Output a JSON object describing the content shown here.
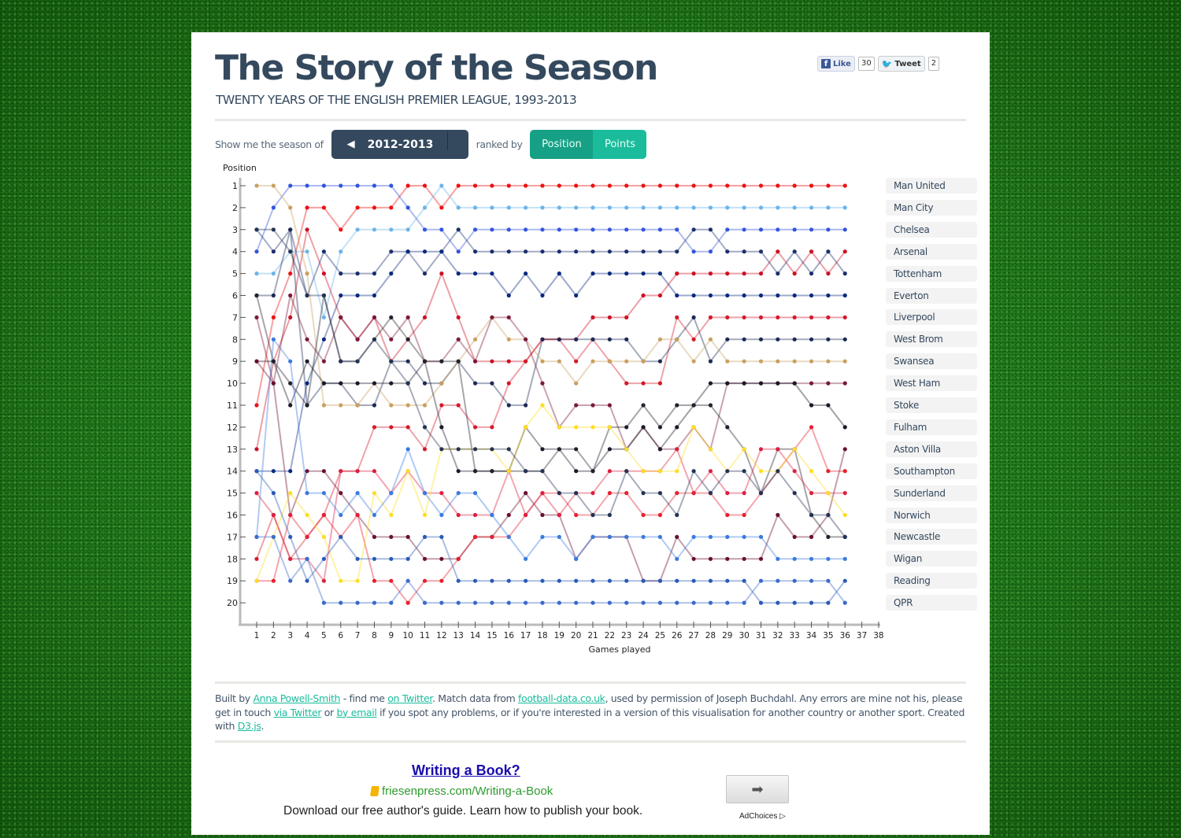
{
  "header": {
    "title": "The Story of the Season",
    "subtitle": "TWENTY YEARS OF THE ENGLISH PREMIER LEAGUE, 1993-2013"
  },
  "social": {
    "like_label": "Like",
    "like_count": "30",
    "tweet_label": "Tweet",
    "tweet_count": "2"
  },
  "controls": {
    "season_prompt": "Show me the season of",
    "season_value": "2012-2013",
    "rank_prompt": "ranked by",
    "rank_options": [
      "Position",
      "Points"
    ],
    "rank_selected": "Position"
  },
  "chart_data": {
    "type": "line",
    "title": "",
    "xlabel": "Games played",
    "ylabel": "Position",
    "xlim": [
      1,
      38
    ],
    "ylim": [
      1,
      20
    ],
    "x_ticks": [
      1,
      2,
      3,
      4,
      5,
      6,
      7,
      8,
      9,
      10,
      11,
      12,
      13,
      14,
      15,
      16,
      17,
      18,
      19,
      20,
      21,
      22,
      23,
      24,
      25,
      26,
      27,
      28,
      29,
      30,
      31,
      32,
      33,
      34,
      35,
      36,
      37,
      38
    ],
    "y_ticks": [
      1,
      2,
      3,
      4,
      5,
      6,
      7,
      8,
      9,
      10,
      11,
      12,
      13,
      14,
      15,
      16,
      17,
      18,
      19,
      20
    ],
    "games_played": 36,
    "legend_placement": "right",
    "series": [
      {
        "name": "Man United",
        "color": "#ee1111",
        "values": [
          11,
          7,
          5,
          2,
          2,
          3,
          2,
          2,
          2,
          1,
          1,
          2,
          1,
          1,
          1,
          1,
          1,
          1,
          1,
          1,
          1,
          1,
          1,
          1,
          1,
          1,
          1,
          1,
          1,
          1,
          1,
          1,
          1,
          1,
          1,
          1
        ]
      },
      {
        "name": "Man City",
        "color": "#6cb4e8",
        "values": [
          5,
          5,
          4,
          4,
          7,
          4,
          3,
          3,
          3,
          3,
          2,
          1,
          2,
          2,
          2,
          2,
          2,
          2,
          2,
          2,
          2,
          2,
          2,
          2,
          2,
          2,
          2,
          2,
          2,
          2,
          2,
          2,
          2,
          2,
          2,
          2
        ]
      },
      {
        "name": "Chelsea",
        "color": "#3355dd",
        "values": [
          4,
          2,
          1,
          1,
          1,
          1,
          1,
          1,
          1,
          2,
          3,
          3,
          4,
          3,
          3,
          3,
          3,
          3,
          3,
          3,
          3,
          3,
          3,
          3,
          3,
          3,
          4,
          4,
          3,
          3,
          3,
          3,
          3,
          3,
          3,
          3
        ]
      },
      {
        "name": "Arsenal",
        "color": "#cc1122",
        "values": [
          13,
          9,
          7,
          3,
          5,
          7,
          8,
          7,
          9,
          8,
          7,
          5,
          7,
          9,
          9,
          9,
          9,
          8,
          8,
          8,
          7,
          7,
          7,
          6,
          6,
          5,
          5,
          5,
          5,
          5,
          5,
          4,
          5,
          4,
          5,
          4
        ]
      },
      {
        "name": "Tottenham",
        "color": "#1a2f6e",
        "values": [
          3,
          4,
          3,
          6,
          4,
          5,
          5,
          5,
          4,
          4,
          5,
          4,
          3,
          4,
          4,
          4,
          4,
          4,
          4,
          4,
          4,
          4,
          4,
          4,
          4,
          4,
          3,
          3,
          4,
          4,
          4,
          5,
          4,
          5,
          4,
          5
        ]
      },
      {
        "name": "Everton",
        "color": "#0a2a80",
        "values": [
          14,
          14,
          14,
          10,
          8,
          6,
          6,
          6,
          5,
          4,
          4,
          4,
          5,
          5,
          5,
          6,
          5,
          6,
          5,
          6,
          5,
          5,
          5,
          5,
          5,
          6,
          6,
          6,
          6,
          6,
          6,
          6,
          6,
          6,
          6,
          6
        ]
      },
      {
        "name": "Liverpool",
        "color": "#d41a2a",
        "values": [
          18,
          16,
          18,
          17,
          16,
          14,
          14,
          12,
          12,
          12,
          13,
          11,
          11,
          12,
          12,
          10,
          9,
          8,
          8,
          9,
          8,
          9,
          10,
          10,
          10,
          7,
          8,
          7,
          7,
          7,
          7,
          7,
          7,
          7,
          7,
          7
        ]
      },
      {
        "name": "West Brom",
        "color": "#1c2a55",
        "values": [
          6,
          6,
          3,
          11,
          10,
          10,
          11,
          11,
          9,
          9,
          10,
          10,
          9,
          10,
          10,
          11,
          11,
          8,
          8,
          8,
          8,
          8,
          8,
          9,
          9,
          8,
          7,
          9,
          8,
          8,
          8,
          8,
          8,
          8,
          8,
          8
        ]
      },
      {
        "name": "Swansea",
        "color": "#c9a060",
        "values": [
          1,
          1,
          2,
          5,
          11,
          11,
          11,
          10,
          11,
          11,
          11,
          10,
          9,
          8,
          7,
          8,
          8,
          9,
          9,
          10,
          9,
          9,
          9,
          9,
          8,
          8,
          9,
          8,
          9,
          9,
          9,
          9,
          9,
          9,
          9,
          9
        ]
      },
      {
        "name": "West Ham",
        "color": "#7a1a3a",
        "values": [
          7,
          10,
          6,
          8,
          9,
          7,
          8,
          7,
          8,
          7,
          9,
          9,
          8,
          9,
          7,
          7,
          8,
          10,
          12,
          11,
          11,
          11,
          13,
          12,
          13,
          13,
          12,
          13,
          10,
          10,
          10,
          10,
          10,
          10,
          10,
          10
        ]
      },
      {
        "name": "Stoke",
        "color": "#1a1a2a",
        "values": [
          9,
          9,
          11,
          9,
          10,
          10,
          10,
          10,
          10,
          10,
          9,
          12,
          14,
          14,
          14,
          14,
          12,
          13,
          13,
          14,
          14,
          13,
          13,
          12,
          13,
          12,
          11,
          10,
          10,
          10,
          10,
          10,
          10,
          11,
          11,
          12
        ]
      },
      {
        "name": "Fulham",
        "color": "#22222e",
        "values": [
          6,
          9,
          10,
          11,
          6,
          9,
          9,
          8,
          7,
          8,
          9,
          9,
          9,
          14,
          14,
          14,
          14,
          14,
          13,
          13,
          14,
          12,
          12,
          11,
          12,
          11,
          11,
          11,
          12,
          13,
          15,
          13,
          13,
          16,
          17,
          17
        ]
      },
      {
        "name": "Aston Villa",
        "color": "#6a1030",
        "values": [
          9,
          10,
          16,
          14,
          14,
          15,
          16,
          17,
          17,
          17,
          18,
          18,
          18,
          17,
          17,
          16,
          15,
          16,
          16,
          18,
          17,
          17,
          17,
          19,
          19,
          17,
          18,
          18,
          18,
          18,
          18,
          16,
          17,
          17,
          16,
          13
        ]
      },
      {
        "name": "Southampton",
        "color": "#e52030",
        "values": [
          19,
          19,
          16,
          17,
          16,
          17,
          16,
          19,
          19,
          20,
          19,
          19,
          18,
          17,
          17,
          17,
          16,
          15,
          15,
          16,
          16,
          15,
          15,
          16,
          16,
          15,
          15,
          15,
          16,
          16,
          15,
          14,
          13,
          12,
          14,
          14
        ]
      },
      {
        "name": "Sunderland",
        "color": "#dd2040",
        "values": [
          15,
          16,
          18,
          18,
          19,
          14,
          14,
          14,
          15,
          14,
          15,
          15,
          16,
          16,
          16,
          14,
          16,
          15,
          16,
          15,
          15,
          14,
          14,
          14,
          14,
          13,
          15,
          14,
          15,
          15,
          13,
          13,
          14,
          15,
          15,
          15
        ]
      },
      {
        "name": "Norwich",
        "color": "#ffdd22",
        "values": [
          19,
          17,
          15,
          16,
          17,
          19,
          19,
          15,
          16,
          14,
          16,
          13,
          13,
          13,
          13,
          14,
          12,
          11,
          12,
          12,
          12,
          12,
          13,
          14,
          14,
          14,
          12,
          13,
          14,
          13,
          14,
          14,
          13,
          14,
          15,
          16
        ]
      },
      {
        "name": "Newcastle",
        "color": "#223355",
        "values": [
          3,
          3,
          4,
          6,
          6,
          9,
          9,
          8,
          9,
          10,
          12,
          13,
          13,
          13,
          13,
          13,
          14,
          14,
          15,
          15,
          16,
          16,
          14,
          15,
          15,
          16,
          14,
          15,
          14,
          14,
          15,
          14,
          15,
          16,
          16,
          17
        ]
      },
      {
        "name": "Wigan",
        "color": "#3a7ae0",
        "values": [
          17,
          8,
          9,
          15,
          15,
          16,
          15,
          16,
          15,
          13,
          15,
          16,
          15,
          15,
          16,
          17,
          18,
          17,
          17,
          18,
          17,
          17,
          17,
          17,
          17,
          18,
          17,
          17,
          17,
          17,
          17,
          18,
          18,
          18,
          18,
          18
        ]
      },
      {
        "name": "Reading",
        "color": "#2a5ab8",
        "values": [
          14,
          15,
          17,
          19,
          18,
          17,
          18,
          18,
          18,
          18,
          17,
          17,
          19,
          19,
          19,
          19,
          19,
          19,
          19,
          19,
          19,
          19,
          19,
          19,
          19,
          19,
          19,
          19,
          19,
          19,
          20,
          20,
          20,
          20,
          20,
          19
        ]
      },
      {
        "name": "QPR",
        "color": "#3a6acc",
        "values": [
          17,
          17,
          19,
          18,
          20,
          20,
          20,
          20,
          20,
          19,
          20,
          20,
          20,
          20,
          20,
          20,
          20,
          20,
          20,
          20,
          20,
          20,
          20,
          20,
          20,
          20,
          20,
          20,
          20,
          20,
          19,
          19,
          19,
          19,
          19,
          20
        ]
      }
    ],
    "final_table": [
      "Man United",
      "Man City",
      "Chelsea",
      "Arsenal",
      "Tottenham",
      "Everton",
      "Liverpool",
      "West Brom",
      "Swansea",
      "West Ham",
      "Stoke",
      "Fulham",
      "Aston Villa",
      "Southampton",
      "Sunderland",
      "Norwich",
      "Newcastle",
      "Wigan",
      "Reading",
      "QPR"
    ]
  },
  "footer": {
    "parts": [
      {
        "t": "Built by "
      },
      {
        "t": "Anna Powell-Smith",
        "link": true
      },
      {
        "t": " - find me "
      },
      {
        "t": "on Twitter",
        "link": true
      },
      {
        "t": ". Match data from "
      },
      {
        "t": "football-data.co.uk",
        "link": true
      },
      {
        "t": ", used by permission of Joseph Buchdahl. Any errors are mine not his, please get in touch "
      },
      {
        "t": "via Twitter",
        "link": true
      },
      {
        "t": " or "
      },
      {
        "t": "by email",
        "link": true
      },
      {
        "t": " if you spot any problems, or if you're interested in a version of this visualisation for another country or another sport. Created with "
      },
      {
        "t": "D3.js",
        "link": true
      },
      {
        "t": "."
      }
    ]
  },
  "ad": {
    "title": "Writing a Book?",
    "url": "friesenpress.com/Writing-a-Book",
    "description": "Download our free author's guide. Learn how to publish your book.",
    "go_icon": "arrow-right-icon",
    "choices_label": "AdChoices ▷"
  }
}
